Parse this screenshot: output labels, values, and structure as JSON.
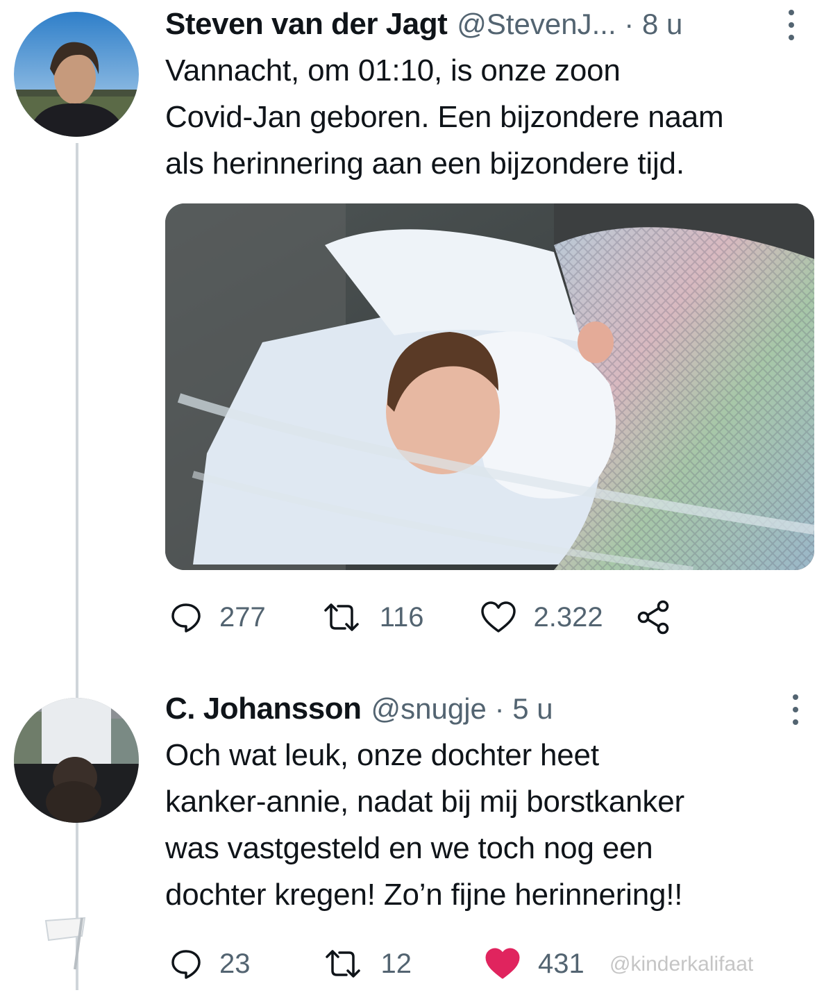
{
  "tweet1": {
    "display_name": "Steven van der Jagt",
    "handle_time": "@StevenJ... · 8 u",
    "text_lines": [
      "Vannacht, om 01:10, is onze zoon",
      "Covid-Jan geboren. Een bijzondere naam",
      "als herinnering aan een bijzondere tijd."
    ],
    "replies": "277",
    "retweets": "116",
    "likes": "2.322"
  },
  "tweet2": {
    "display_name": "C. Johansson",
    "handle_time": "@snugje · 5 u",
    "text_lines": [
      "Och wat leuk, onze dochter heet",
      "kanker-annie, nadat bij mij borstkanker",
      "was vastgesteld en we toch nog een",
      "dochter kregen! Zo’n fijne herinnering!!"
    ],
    "replies": "23",
    "retweets": "12",
    "likes": "431",
    "liked": true
  },
  "watermark": "@kinderkalifaat",
  "icons": {
    "reply": "reply-icon",
    "retweet": "retweet-icon",
    "like": "heart-icon",
    "share": "share-icon",
    "menu": "more-vertical-icon"
  },
  "colors": {
    "text": "#0f1419",
    "secondary": "#536471",
    "like_active": "#e0245e",
    "thread_line": "#cfd5da"
  }
}
